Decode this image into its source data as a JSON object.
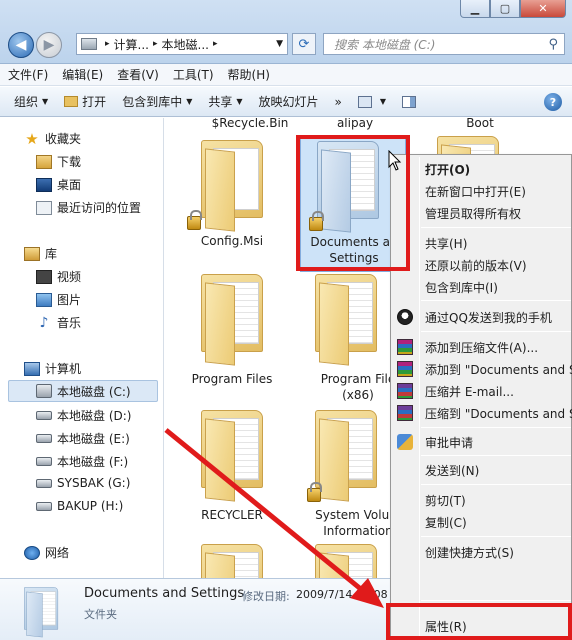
{
  "address": {
    "seg1": "计算...",
    "seg2": "本地磁..."
  },
  "search": {
    "placeholder": "搜索 本地磁盘 (C:)"
  },
  "menubar": [
    "文件(F)",
    "编辑(E)",
    "查看(V)",
    "工具(T)",
    "帮助(H)"
  ],
  "toolbar": {
    "organize": "组织",
    "open": "打开",
    "include": "包含到库中",
    "share": "共享",
    "slideshow": "放映幻灯片",
    "more": "»"
  },
  "sidebar": {
    "favorites": "收藏夹",
    "downloads": "下载",
    "desktop": "桌面",
    "recent": "最近访问的位置",
    "libraries": "库",
    "video": "视频",
    "pictures": "图片",
    "music": "音乐",
    "computer": "计算机",
    "drive_c": "本地磁盘 (C:)",
    "drive_d": "本地磁盘 (D:)",
    "drive_e": "本地磁盘 (E:)",
    "drive_f": "本地磁盘 (F:)",
    "drive_g": "SYSBAK (G:)",
    "drive_h": "BAKUP (H:)",
    "network": "网络"
  },
  "files": {
    "recycle": "$Recycle.Bin",
    "alipay": "alipay",
    "boot": "Boot",
    "config": "Config.Msi",
    "docs_line1": "Documents an",
    "docs_line2": "Settings",
    "program_files": "Program Files",
    "program_files_x86_1": "Program File",
    "program_files_x86_2": "(x86)",
    "recycler": "RECYCLER",
    "svi_1": "System Volum",
    "svi_2": "Information"
  },
  "details": {
    "name": "Documents and Settings",
    "date_label": "修改日期:",
    "date_value": "2009/7/14 13:08",
    "type": "文件夹"
  },
  "context_menu": {
    "open": "打开(O)",
    "open_new_window": "在新窗口中打开(E)",
    "admin_access": "管理员取得所有权",
    "share": "共享(H)",
    "restore": "还原以前的版本(V)",
    "include": "包含到库中(I)",
    "qq_send": "通过QQ发送到我的手机",
    "add_archive": "添加到压缩文件(A)...",
    "add_to_named": "添加到 \"Documents and S",
    "compress_email": "压缩并 E-mail...",
    "compress_to": "压缩到 \"Documents and S",
    "approve": "审批申请",
    "send_to": "发送到(N)",
    "cut": "剪切(T)",
    "copy": "复制(C)",
    "shortcut": "创建快捷方式(S)",
    "properties": "属性(R)"
  },
  "colors": {
    "highlight": "#e01b1b",
    "selection": "#cde3f8"
  }
}
